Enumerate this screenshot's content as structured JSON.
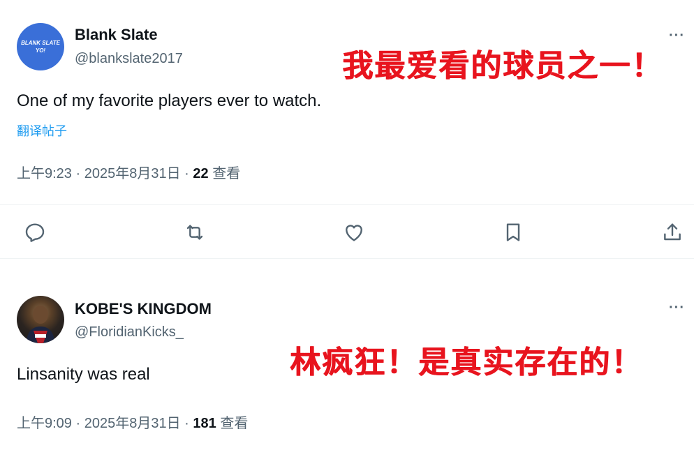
{
  "tweets": [
    {
      "avatar_text": [
        "BLANK SLATE",
        "YO!"
      ],
      "display_name": "Blank Slate",
      "handle": "@blankslate2017",
      "text": "One of my favorite players ever to watch.",
      "translate_label": "翻译帖子",
      "time": "上午9:23",
      "separator": "·",
      "date": "2025年8月31日",
      "views_count": "22",
      "views_label": "查看",
      "more_label": "···",
      "annotation": "我最爱看的球员之一！"
    },
    {
      "display_name": "KOBE'S KINGDOM",
      "handle": "@FloridianKicks_",
      "text": "Linsanity was real",
      "time": "上午9:09",
      "separator": "·",
      "date": "2025年8月31日",
      "views_count": "181",
      "views_label": "查看",
      "more_label": "···",
      "annotation": "林疯狂！是真实存在的！"
    }
  ],
  "actions": [
    {
      "name": "reply-icon"
    },
    {
      "name": "retweet-icon"
    },
    {
      "name": "like-icon"
    },
    {
      "name": "bookmark-icon"
    },
    {
      "name": "share-icon"
    }
  ],
  "colors": {
    "text": "#0f1419",
    "secondary": "#536471",
    "link": "#1d9bf0",
    "annotation": "#e8141e",
    "avatar_bg": "#3a6fd8"
  }
}
